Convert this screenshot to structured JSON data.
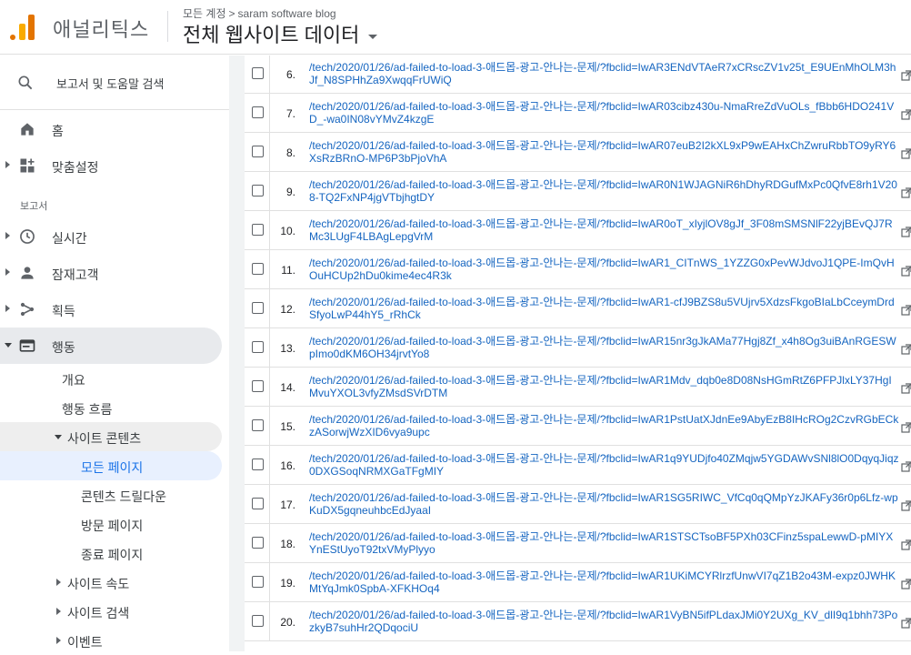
{
  "header": {
    "app_name": "애널리틱스",
    "breadcrumb_account": "모든 계정",
    "breadcrumb_sep": ">",
    "breadcrumb_property": "saram software blog",
    "view_name": "전체 웹사이트 데이터"
  },
  "colors": {
    "logo_dark": "#e37400",
    "logo_light": "#f9ab00",
    "link": "#1565c0",
    "selected_bg": "#e8f0fe",
    "selected_text": "#1a73e8"
  },
  "sidebar": {
    "search_label": "보고서 및 도움말 검색",
    "home": "홈",
    "customization": "맞춤설정",
    "reports_section": "보고서",
    "realtime": "실시간",
    "audience": "잠재고객",
    "acquisition": "획득",
    "behavior": "행동",
    "behavior_items": {
      "overview": "개요",
      "behavior_flow": "행동 흐름",
      "site_content": "사이트 콘텐츠",
      "all_pages": "모든 페이지",
      "content_drilldown": "콘텐츠 드릴다운",
      "landing_pages": "방문 페이지",
      "exit_pages": "종료 페이지",
      "site_speed": "사이트 속도",
      "site_search": "사이트 검색",
      "events": "이벤트"
    }
  },
  "table": {
    "rows": [
      {
        "idx": "6.",
        "url": "/tech/2020/01/26/ad-failed-to-load-3-애드몹-광고-안나는-문제/?fbclid=IwAR3ENdVTAeR7xCRscZV1v25t_E9UEnMhOLM3hJf_N8SPHhZa9XwqqFrUWiQ"
      },
      {
        "idx": "7.",
        "url": "/tech/2020/01/26/ad-failed-to-load-3-애드몹-광고-안나는-문제/?fbclid=IwAR03cibz430u-NmaRreZdVuOLs_fBbb6HDO241VD_-wa0IN08vYMvZ4kzgE"
      },
      {
        "idx": "8.",
        "url": "/tech/2020/01/26/ad-failed-to-load-3-애드몹-광고-안나는-문제/?fbclid=IwAR07euB2I2kXL9xP9wEAHxChZwruRbbTO9yRY6XsRzBRnO-MP6P3bPjoVhA"
      },
      {
        "idx": "9.",
        "url": "/tech/2020/01/26/ad-failed-to-load-3-애드몹-광고-안나는-문제/?fbclid=IwAR0N1WJAGNiR6hDhyRDGufMxPc0QfvE8rh1V208-TQ2FxNP4jgVTbjhgtDY"
      },
      {
        "idx": "10.",
        "url": "/tech/2020/01/26/ad-failed-to-load-3-애드몹-광고-안나는-문제/?fbclid=IwAR0oT_xIyjlOV8gJf_3F08mSMSNlF22yjBEvQJ7RMc3LUgF4LBAgLepgVrM"
      },
      {
        "idx": "11.",
        "url": "/tech/2020/01/26/ad-failed-to-load-3-애드몹-광고-안나는-문제/?fbclid=IwAR1_CITnWS_1YZZG0xPevWJdvoJ1QPE-ImQvHOuHCUp2hDu0kime4ec4R3k"
      },
      {
        "idx": "12.",
        "url": "/tech/2020/01/26/ad-failed-to-load-3-애드몹-광고-안나는-문제/?fbclid=IwAR1-cfJ9BZS8u5VUjrv5XdzsFkgoBIaLbCceymDrdSfyoLwP44hY5_rRhCk"
      },
      {
        "idx": "13.",
        "url": "/tech/2020/01/26/ad-failed-to-load-3-애드몹-광고-안나는-문제/?fbclid=IwAR15nr3gJkAMa77Hgj8Zf_x4h8Og3uiBAnRGESWpImo0dKM6OH34jrvtYo8"
      },
      {
        "idx": "14.",
        "url": "/tech/2020/01/26/ad-failed-to-load-3-애드몹-광고-안나는-문제/?fbclid=IwAR1Mdv_dqb0e8D08NsHGmRtZ6PFPJlxLY37HgIMvuYXOL3vfyZMsdSVrDTM"
      },
      {
        "idx": "15.",
        "url": "/tech/2020/01/26/ad-failed-to-load-3-애드몹-광고-안나는-문제/?fbclid=IwAR1PstUatXJdnEe9AbyEzB8IHcROg2CzvRGbECkzASorwjWzXID6vya9upc"
      },
      {
        "idx": "16.",
        "url": "/tech/2020/01/26/ad-failed-to-load-3-애드몹-광고-안나는-문제/?fbclid=IwAR1q9YUDjfo40ZMqjw5YGDAWvSNl8lO0DqyqJiqz0DXGSoqNRMXGaTFgMIY"
      },
      {
        "idx": "17.",
        "url": "/tech/2020/01/26/ad-failed-to-load-3-애드몹-광고-안나는-문제/?fbclid=IwAR1SG5RIWC_VfCq0qQMpYzJKAFy36r0p6Lfz-wpKuDX5gqneuhbcEdJyaaI"
      },
      {
        "idx": "18.",
        "url": "/tech/2020/01/26/ad-failed-to-load-3-애드몹-광고-안나는-문제/?fbclid=IwAR1STSCTsoBF5PXh03CFinz5spaLewwD-pMIYXYnEStUyoT92txVMyPlyyo"
      },
      {
        "idx": "19.",
        "url": "/tech/2020/01/26/ad-failed-to-load-3-애드몹-광고-안나는-문제/?fbclid=IwAR1UKiMCYRlrzfUnwVI7qZ1B2o43M-expz0JWHKMtYqJmk0SpbA-XFKHOq4"
      },
      {
        "idx": "20.",
        "url": "/tech/2020/01/26/ad-failed-to-load-3-애드몹-광고-안나는-문제/?fbclid=IwAR1VyBN5ifPLdaxJMi0Y2UXg_KV_dlI9q1bhh73PozkyB7suhHr2QDqociU"
      }
    ]
  }
}
